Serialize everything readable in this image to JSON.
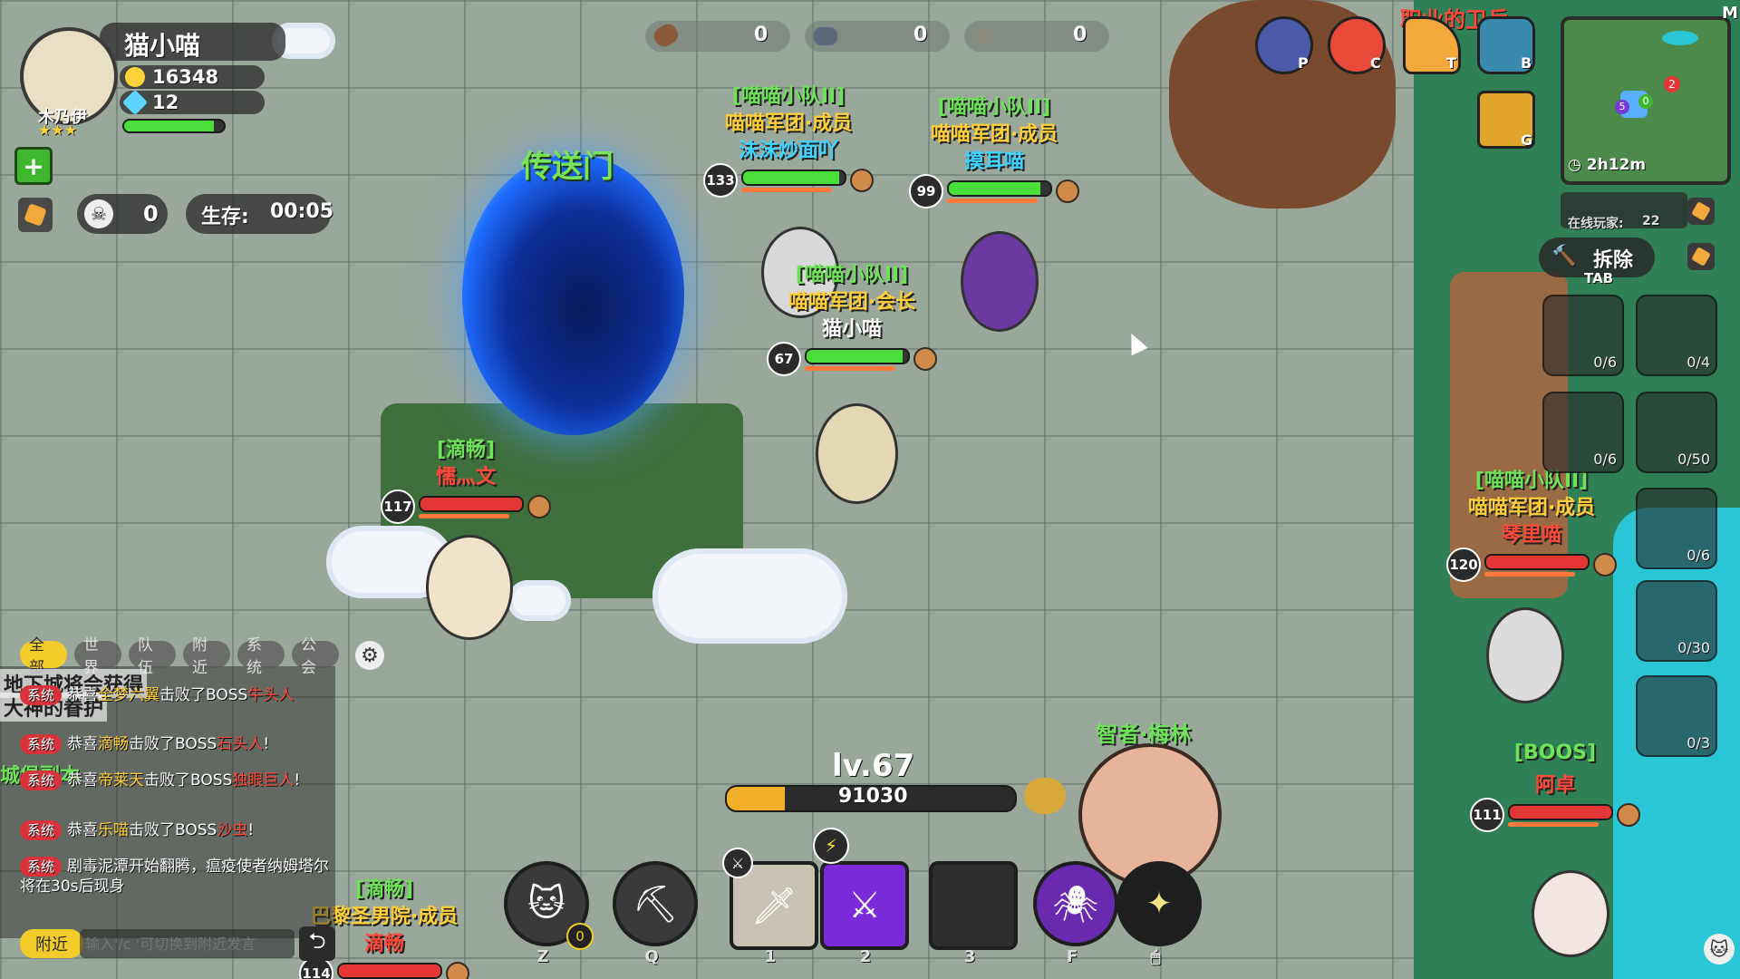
{
  "player": {
    "name": "猫小喵",
    "class_label": "木乃伊",
    "stars": "★★★",
    "gold": "16348",
    "gems": "12",
    "kills": "0",
    "survive_label": "生存:",
    "survive_time": "00:05",
    "hp_fraction": 0.9
  },
  "resources": [
    {
      "icon": "wood-icon",
      "value": "0"
    },
    {
      "icon": "stone-icon",
      "value": "0"
    },
    {
      "icon": "ore-icon",
      "value": "0"
    }
  ],
  "portal_label": "传送门",
  "characters": [
    {
      "squad": "[喵喵小队II]",
      "guild": "喵喵军团·成员",
      "name": "沫沫炒面吖",
      "level": "133",
      "hp": 0.95,
      "bar": "green",
      "name_color": "cyan"
    },
    {
      "squad": "[喵喵小队II]",
      "guild": "喵喵军团·成员",
      "name": "摸耳喵",
      "level": "99",
      "hp": 0.9,
      "bar": "green",
      "name_color": "cyan"
    },
    {
      "squad": "[喵喵小队II]",
      "guild": "喵喵军团·会长",
      "name": "猫小喵",
      "level": "67",
      "hp": 0.95,
      "bar": "green",
      "name_color": "white"
    },
    {
      "squad": "[滴畅]",
      "guild": "",
      "name": "懦灬文",
      "level": "117",
      "hp": 1.0,
      "bar": "red",
      "name_color": "red"
    },
    {
      "squad": "[喵喵小队II]",
      "guild": "喵喵军团·成员",
      "name": "琴里喵",
      "level": "120",
      "hp": 1.0,
      "bar": "red",
      "name_color": "red"
    },
    {
      "squad": "[BOOS]",
      "guild": "",
      "name": "阿卓",
      "level": "111",
      "hp": 1.0,
      "bar": "red",
      "name_color": "red"
    },
    {
      "squad": "[滴畅]",
      "guild": "巴黎圣男院·成员",
      "name": "滴畅",
      "level": "114",
      "hp": 1.0,
      "bar": "red",
      "name_color": "red"
    }
  ],
  "npc_label": "智者·梅林",
  "exp": {
    "level": "lv.67",
    "value": "91030",
    "fraction": 0.2
  },
  "chat": {
    "tabs": [
      "全部",
      "世界",
      "队伍",
      "附近",
      "系统",
      "公会"
    ],
    "active_tab": "全部",
    "banner_line1": "地下城将会获得",
    "banner_line2": "大神的眷护",
    "lines": [
      {
        "badge": "系统",
        "pre": "恭喜",
        "who": "全梦六翼",
        "mid": "击败了BOSS",
        "boss": "牛头人"
      },
      {
        "badge": "系统",
        "pre": "恭喜",
        "who": "滴畅",
        "mid": "击败了BOSS",
        "boss": "石头人",
        "tail": "!"
      },
      {
        "badge": "系统",
        "pre": "恭喜",
        "who": "帝莱天",
        "mid": "击败了BOSS",
        "boss": "独眼巨人",
        "tail": "!"
      },
      {
        "badge": "系统",
        "pre": "恭喜",
        "who": "乐喵",
        "mid": "击败了BOSS",
        "boss": "沙虫",
        "tail": "!"
      },
      {
        "badge": "系统",
        "text": "剧毒泥潭开始翻腾，瘟疫使者纳姆塔尔将在30s后现身"
      }
    ],
    "channel_button": "附近",
    "input_placeholder": "输入'/c '可切换到附近发言",
    "side_label": "城堡副本"
  },
  "skills": [
    {
      "icon": "cat-summon-icon",
      "key": "Z",
      "badge": "0"
    },
    {
      "icon": "pickaxe-icon",
      "key": "Q"
    },
    {
      "icon": "bone-sword-icon",
      "key": "1"
    },
    {
      "icon": "purple-katana-icon",
      "key": "2"
    },
    {
      "icon": "empty-slot",
      "key": "3"
    },
    {
      "icon": "purple-spider-icon",
      "key": "F"
    },
    {
      "icon": "dash-icon",
      "key": "🖱"
    }
  ],
  "top_icons": [
    {
      "icon": "player-icon",
      "key": "P"
    },
    {
      "icon": "cat-face-icon",
      "key": "C"
    },
    {
      "icon": "flag-icon",
      "key": "T"
    },
    {
      "icon": "backpack-icon",
      "key": "B"
    },
    {
      "icon": "guild-rank-icon",
      "key": "G"
    }
  ],
  "minimap": {
    "corner_key": "M",
    "timer": "2h12m",
    "online_label": "在线玩家:",
    "online_count": "22",
    "markers": [
      "2",
      "5",
      "0"
    ]
  },
  "demolish": {
    "label": "拆除",
    "key": "TAB"
  },
  "build_slots": [
    "0/6",
    "0/4",
    "0/6",
    "0/50",
    "0/6",
    "0/30",
    "0/3"
  ],
  "banner_top": "职业的卫兵"
}
